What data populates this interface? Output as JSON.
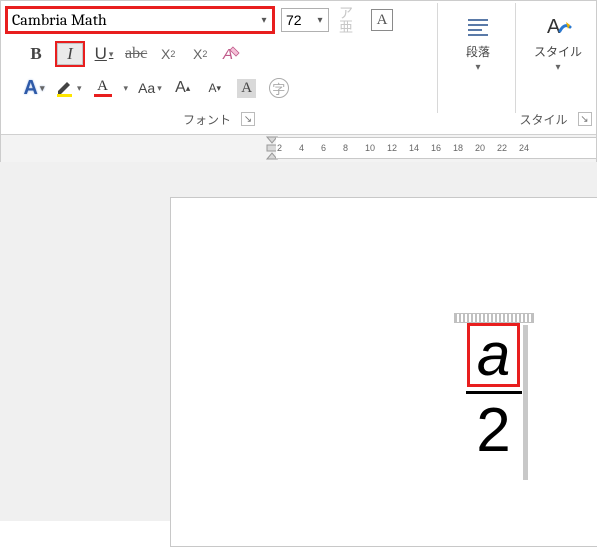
{
  "font": {
    "name": "Cambria Math",
    "size": "72"
  },
  "ghost": {
    "top": "ア",
    "bottom": "亜"
  },
  "tools": {
    "bold": "B",
    "italic": "I",
    "under": "U",
    "strike": "abc",
    "sub_base": "X",
    "sub_s": "2",
    "sup_base": "X",
    "sup_s": "2",
    "clearfmt": "A",
    "outlineA": "A",
    "fontcolorA": "A",
    "caseAa": "Aa",
    "growA_big": "A",
    "growA_small": "A",
    "hilite_shade": "A",
    "circled": "字"
  },
  "groups": {
    "font_label": "フォント",
    "para_label": "段落",
    "styles_label": "スタイル",
    "styles_header": "スタイル"
  },
  "ruler": {
    "ticks": [
      "2",
      "4",
      "6",
      "8",
      "10",
      "12",
      "14",
      "16",
      "18",
      "20",
      "22",
      "24"
    ]
  },
  "equation": {
    "numerator": "a",
    "denominator": "2"
  }
}
